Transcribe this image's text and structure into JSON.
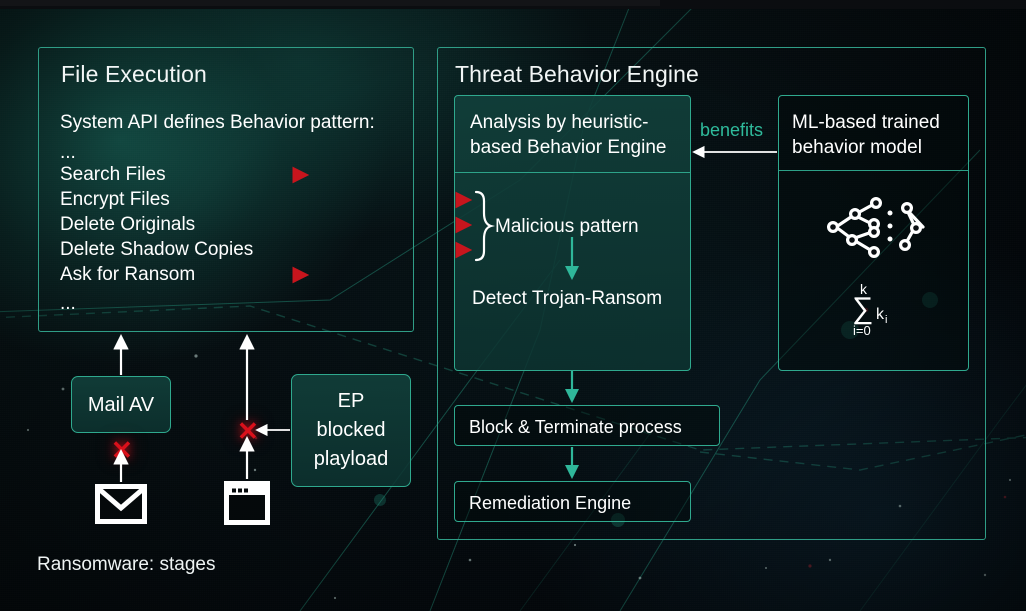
{
  "caption": "Ransomware: stages",
  "colors": {
    "accent_teal": "#2fa98e",
    "label_teal": "#2fbb9c",
    "red_arrow": "#c7151d",
    "red_x": "#d9101b",
    "white": "#ffffff",
    "panel_fill": "#113f3a",
    "background": "#050d10"
  },
  "left_panel": {
    "title": "File Execution",
    "intro": "System API defines Behavior pattern:",
    "ellipsis_top": "...",
    "ellipsis_bottom": "...",
    "steps": [
      {
        "label": "Search Files",
        "arrow": "short"
      },
      {
        "label": "Encrypt Files",
        "arrow": "long"
      },
      {
        "label": "Delete Originals",
        "arrow": "long"
      },
      {
        "label": "Delete Shadow Copies",
        "arrow": "long"
      },
      {
        "label": "Ask for Ransom",
        "arrow": "short"
      }
    ]
  },
  "right_panel": {
    "title": "Threat Behavior Engine",
    "analysis_box": {
      "header": "Analysis by heuristic-\nbased Behavior Engine",
      "pattern_label": "Malicious pattern",
      "detect_label": "Detect Trojan-Ransom"
    },
    "ml_box": {
      "header": "ML-based trained\nbehavior model",
      "icon": "decision-tree-graph-icon",
      "formula": {
        "upper": "k",
        "sigma": "∑",
        "lower": "i=0",
        "term": "k",
        "subscript": "i"
      }
    },
    "benefits_label": "benefits",
    "block_label": "Block & Terminate process",
    "remediation_label": "Remediation Engine"
  },
  "bottom": {
    "mail_av_label": "Mail AV",
    "ep_blocked_label": "EP\nblocked\nplayload",
    "mail_icon": "envelope-icon",
    "browser_icon": "browser-window-icon",
    "block_mark": "✕"
  }
}
